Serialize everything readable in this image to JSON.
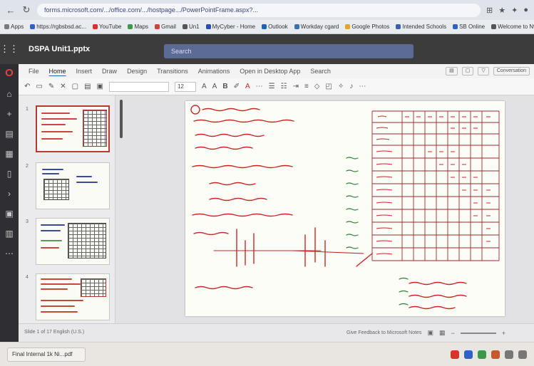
{
  "browser": {
    "url": "forms.microsoft.com/.../office.com/.../hostpage.../PowerPointFrame.aspx?...",
    "bookmarks": [
      {
        "label": "Apps",
        "color": "#7a7a7a"
      },
      {
        "label": "https://rgbsbsd.ac...",
        "color": "#2f62c9"
      },
      {
        "label": "YouTube",
        "color": "#d8322a"
      },
      {
        "label": "Maps",
        "color": "#3a9a4a"
      },
      {
        "label": "Gmail",
        "color": "#c8463a"
      },
      {
        "label": "Un1",
        "color": "#555555"
      },
      {
        "label": "MyCyber - Home",
        "color": "#2a4fa8"
      },
      {
        "label": "Outlook",
        "color": "#1e63b8"
      },
      {
        "label": "Workday cgard",
        "color": "#3a6fb0"
      },
      {
        "label": "Google Photos",
        "color": "#e6a32a"
      },
      {
        "label": "Intended Schools",
        "color": "#3a5fb0"
      },
      {
        "label": "SB Online",
        "color": "#2f62c9"
      },
      {
        "label": "Welcome to Nwu...",
        "color": "#555555"
      }
    ]
  },
  "app": {
    "file_name": "DSPA Unit1.pptx",
    "search_placeholder": "Search"
  },
  "ribbon": {
    "tabs": [
      "File",
      "Home",
      "Insert",
      "Draw",
      "Design",
      "Transitions",
      "Animations",
      "Open in Desktop App",
      "Search"
    ],
    "active_tab": "Home",
    "right_buttons": [
      "▤",
      "▢",
      "▽",
      "Conversation"
    ],
    "font_size": "12"
  },
  "slides": {
    "numbers": [
      "1",
      "2",
      "3",
      "4"
    ]
  },
  "status": {
    "slide_count": "Slide 1 of 17    English (U.S.)",
    "notes": "Give Feedback to Microsoft    Notes"
  },
  "taskbar": {
    "download": "Final Internal 1k Ni...pdf"
  },
  "accent": "#c62828"
}
